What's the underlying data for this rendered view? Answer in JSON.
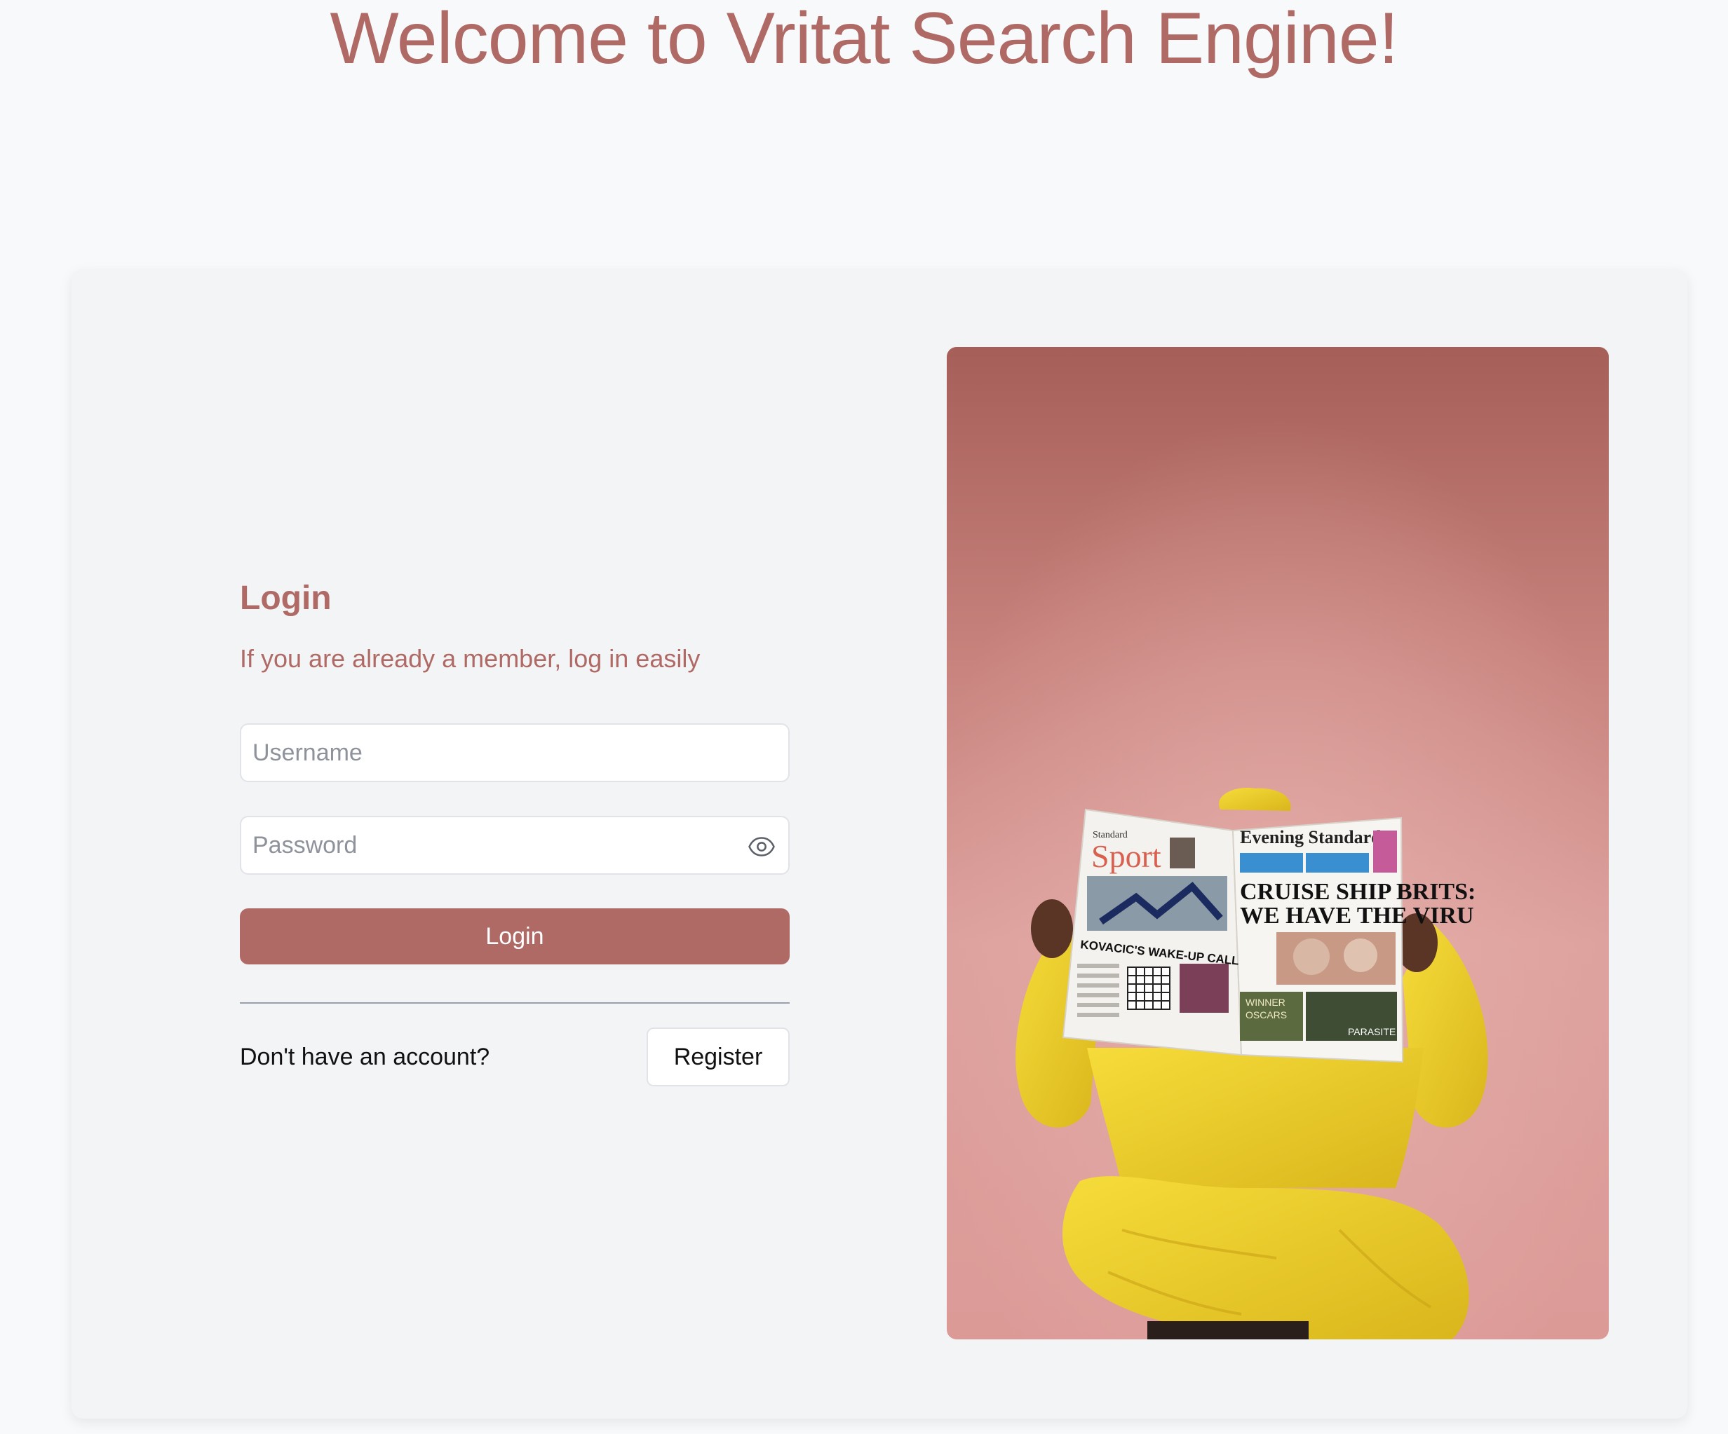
{
  "header": {
    "title": "Welcome to Vritat Search Engine!"
  },
  "login": {
    "heading": "Login",
    "subtitle": "If you are already a member, log in easily",
    "username_placeholder": "Username",
    "password_placeholder": "Password",
    "password_toggle_icon": "eye-icon",
    "submit_label": "Login"
  },
  "register": {
    "prompt": "Don't have an account?",
    "button_label": "Register"
  },
  "hero": {
    "newspaper": {
      "left_masthead": "Sport",
      "left_masthead_small": "Standard",
      "right_masthead": "Evening Standard",
      "headline_line1": "CRUISE SHIP BRITS:",
      "headline_line2": "WE HAVE THE VIRU",
      "sport_headline": "KOVACIC'S WAKE-UP CALL",
      "badge_winner": "WINNER",
      "badge_oscars": "OSCARS",
      "parasite": "PARASITE"
    }
  },
  "colors": {
    "accent": "#b06a66",
    "page_bg": "#f8f9fb",
    "card_bg": "#f3f4f6",
    "hero_bg_top": "#a65f58",
    "hero_bg_bottom": "#dc9a97",
    "suit_yellow": "#f1d22a"
  }
}
